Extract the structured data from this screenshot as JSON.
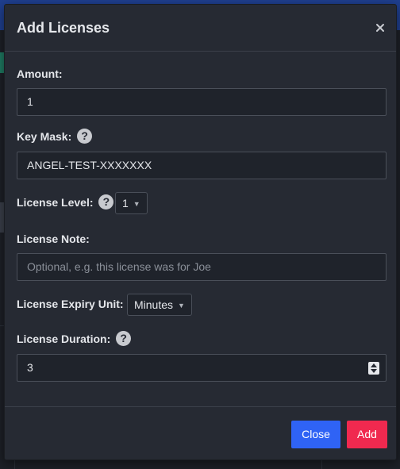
{
  "modal": {
    "title": "Add Licenses",
    "close_icon": "close-icon"
  },
  "fields": {
    "amount": {
      "label": "Amount:",
      "value": "1"
    },
    "key_mask": {
      "label": "Key Mask:",
      "value": "ANGEL-TEST-XXXXXXX",
      "help_icon": "question-circle-icon"
    },
    "license_level": {
      "label": "License Level:",
      "value": "1",
      "help_icon": "question-circle-icon"
    },
    "license_note": {
      "label": "License Note:",
      "placeholder": "Optional, e.g. this license was for Joe"
    },
    "license_expiry_unit": {
      "label": "License Expiry Unit:",
      "value": "Minutes"
    },
    "license_duration": {
      "label": "License Duration:",
      "value": "3",
      "help_icon": "question-circle-icon"
    }
  },
  "footer": {
    "close_label": "Close",
    "add_label": "Add"
  },
  "colors": {
    "primary": "#2f63f5",
    "danger": "#f0294f",
    "modal_bg": "#262a33"
  }
}
